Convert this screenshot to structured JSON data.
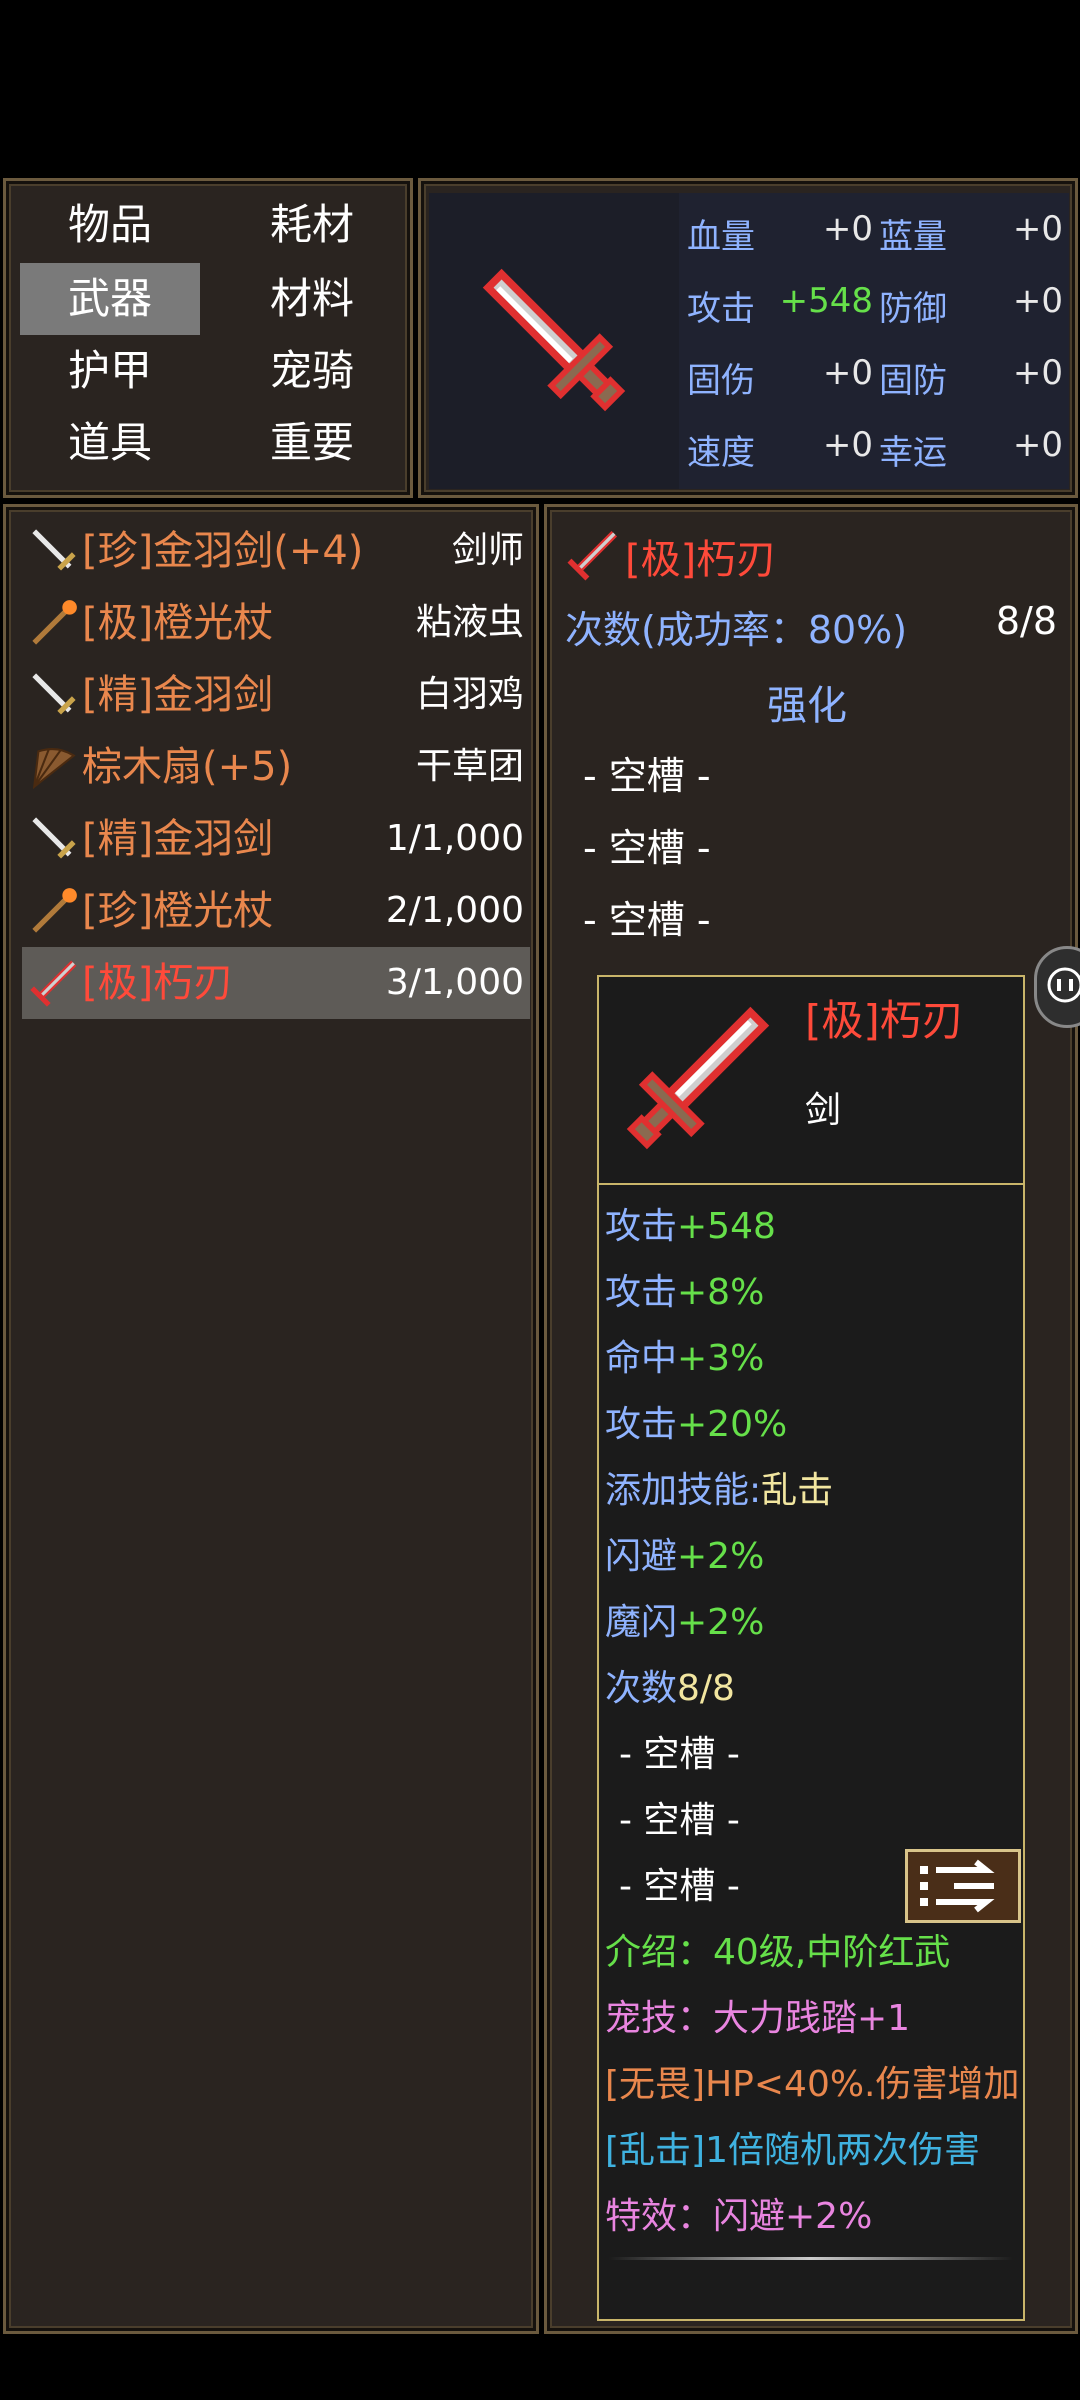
{
  "categories": {
    "items": [
      "物品",
      "耗材",
      "武器",
      "材料",
      "护甲",
      "宠骑",
      "道具",
      "重要"
    ],
    "selected": "武器"
  },
  "stats": [
    {
      "name": "血量",
      "value": "+0"
    },
    {
      "name": "蓝量",
      "value": "+0"
    },
    {
      "name": "攻击",
      "value": "+548"
    },
    {
      "name": "防御",
      "value": "+0"
    },
    {
      "name": "固伤",
      "value": "+0"
    },
    {
      "name": "固防",
      "value": "+0"
    },
    {
      "name": "速度",
      "value": "+0"
    },
    {
      "name": "幸运",
      "value": "+0"
    }
  ],
  "inventory": [
    {
      "name": "[珍]金羽剑(+4)",
      "right": "剑师",
      "icon": "sword-icon"
    },
    {
      "name": "[极]橙光杖",
      "right": "粘液虫",
      "icon": "staff-icon"
    },
    {
      "name": "[精]金羽剑",
      "right": "白羽鸡",
      "icon": "sword-icon"
    },
    {
      "name": "棕木扇(+5)",
      "right": "干草团",
      "icon": "fan-icon"
    },
    {
      "name": "[精]金羽剑",
      "right": "1/1,000",
      "icon": "sword-icon"
    },
    {
      "name": "[珍]橙光杖",
      "right": "2/1,000",
      "icon": "staff-icon"
    },
    {
      "name": "[极]朽刃",
      "right": "3/1,000",
      "icon": "red-blade-icon"
    }
  ],
  "selected_item": {
    "name": "[极]朽刃",
    "uses_label": "次数(成功率：80%)",
    "uses_value": "8/8",
    "enhance_label": "强化",
    "slots": [
      "- 空槽 -",
      "- 空槽 -",
      "- 空槽 -"
    ]
  },
  "tooltip": {
    "name": "[极]朽刃",
    "type": "剑",
    "lines": [
      {
        "a": "攻击",
        "b": "+548"
      },
      {
        "a": "攻击",
        "b": "+8%"
      },
      {
        "a": "命中",
        "b": "+3%"
      },
      {
        "a": "攻击",
        "b": "+20%"
      },
      {
        "a": "添加技能:",
        "b": "乱击"
      },
      {
        "a": "闪避",
        "b": "+2%"
      },
      {
        "a": "魔闪",
        "b": "+2%"
      },
      {
        "a": "次数",
        "b": "8/8"
      }
    ],
    "slots": [
      "- 空槽 -",
      "- 空槽 -",
      "- 空槽 -"
    ],
    "intro": "介绍：40级,中阶红武",
    "pet_skill": "宠技：大力践踏+1",
    "fearless": "[无畏]HP<40%.伤害增加",
    "chaos": "[乱击]1倍随机两次伤害",
    "effect": "特效：闪避+2%"
  }
}
